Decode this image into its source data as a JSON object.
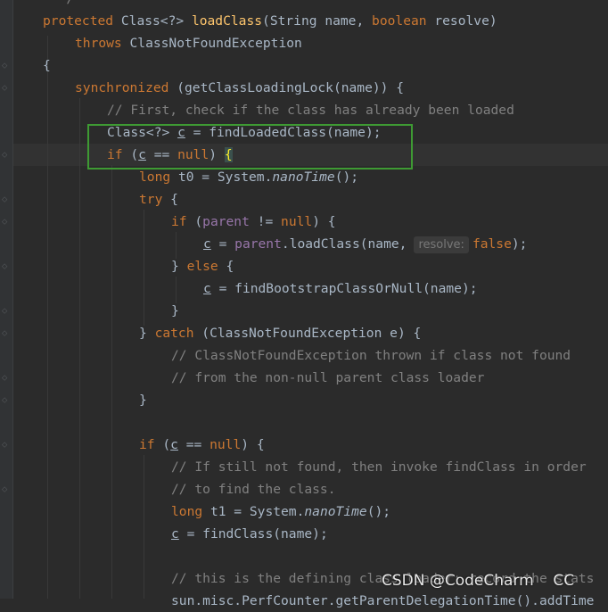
{
  "editor": {
    "lines": {
      "l0": "  */",
      "l1_kw": "protected ",
      "l1_type": "Class<?> ",
      "l1_fn": "loadClass",
      "l1_p1": "(String name, ",
      "l1_kw2": "boolean",
      "l1_p2": " resolve)",
      "l2_kw": "throws",
      "l2_txt": " ClassNotFoundException",
      "l3": "{",
      "l4_kw": "synchronized",
      "l4_txt": " (getClassLoadingLock(name)) {",
      "l5_cm": "// First, check if the class has already been loaded",
      "l6_a": "Class<?> ",
      "l6_var": "c",
      "l6_b": " = findLoadedClass(name);",
      "l7_kw": "if",
      "l7_a": " (",
      "l7_var": "c",
      "l7_b": " == ",
      "l7_kw2": "null",
      "l7_c": ") ",
      "l7_br": "{",
      "l8_kw": "long",
      "l8_a": " t0 = System.",
      "l8_it": "nanoTime",
      "l8_b": "();",
      "l9_kw": "try",
      "l9_a": " {",
      "l10_kw": "if",
      "l10_a": " (",
      "l10_fld": "parent",
      "l10_b": " != ",
      "l10_kw2": "null",
      "l10_c": ") {",
      "l11_var": "c",
      "l11_a": " = ",
      "l11_fld": "parent",
      "l11_b": ".loadClass(name,",
      "l11_hint": "resolve:",
      "l11_kw": "false",
      "l11_c": ");",
      "l12_a": "} ",
      "l12_kw": "else",
      "l12_b": " {",
      "l13_var": "c",
      "l13_a": " = findBootstrapClassOrNull(name);",
      "l14": "}",
      "l15_a": "} ",
      "l15_kw": "catch",
      "l15_b": " (ClassNotFoundException e) {",
      "l16_cm": "// ClassNotFoundException thrown if class not found",
      "l17_cm": "// from the non-null parent class loader",
      "l18": "}",
      "l20_kw": "if",
      "l20_a": " (",
      "l20_var": "c",
      "l20_b": " == ",
      "l20_kw2": "null",
      "l20_c": ") {",
      "l21_cm": "// If still not found, then invoke findClass in order",
      "l22_cm": "// to find the class.",
      "l23_kw": "long",
      "l23_a": " t1 = System.",
      "l23_it": "nanoTime",
      "l23_b": "();",
      "l24_var": "c",
      "l24_a": " = findClass(name);",
      "l26_cm": "// this is the defining class loader; record the stats",
      "l27": "sun.misc.PerfCounter.getParentDelegationTime().addTime"
    }
  },
  "watermark": "CSDN @CodeCharm    CC",
  "colors": {
    "background": "#2b2b2b",
    "keyword": "#cc7832",
    "comment": "#808080",
    "method": "#ffc66d",
    "field": "#9876aa",
    "highlight_box": "#3e9a33"
  }
}
